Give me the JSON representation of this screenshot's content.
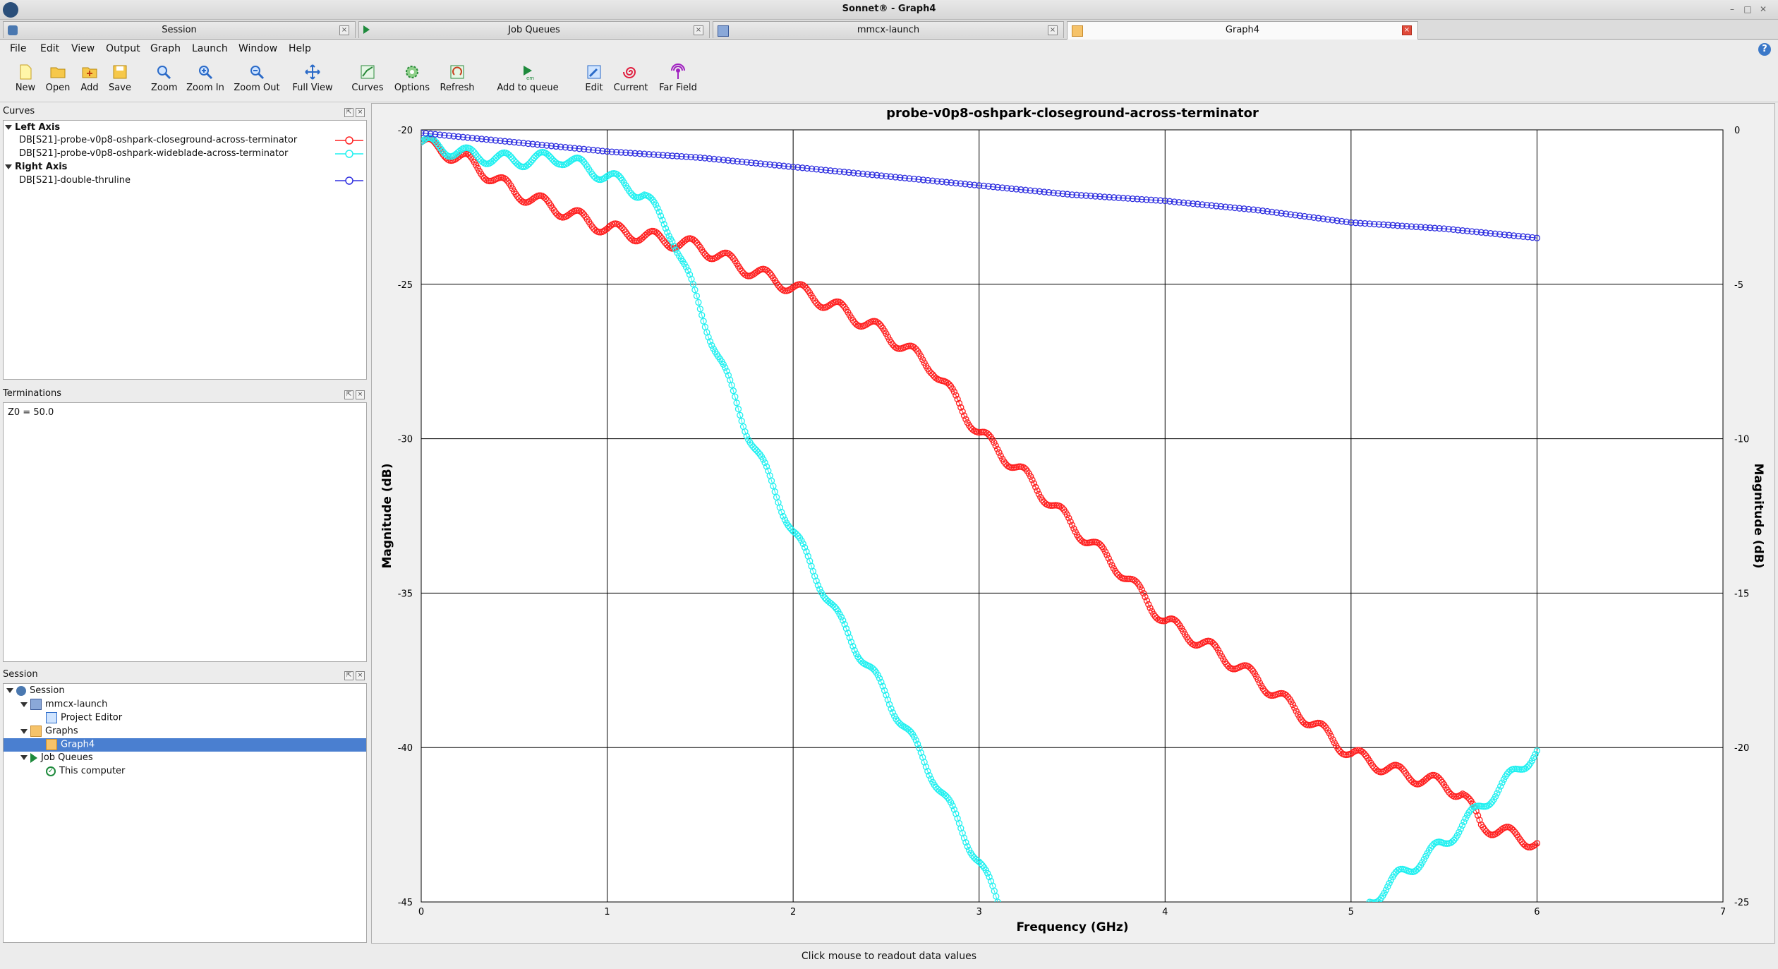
{
  "window": {
    "title": "Sonnet® - Graph4"
  },
  "tabs": [
    {
      "label": "Session",
      "active": false
    },
    {
      "label": "Job Queues",
      "active": false
    },
    {
      "label": "mmcx-launch",
      "active": false
    },
    {
      "label": "Graph4",
      "active": true
    }
  ],
  "menu": [
    "File",
    "Edit",
    "View",
    "Output",
    "Graph",
    "Launch",
    "Window",
    "Help"
  ],
  "toolbar": [
    "New",
    "Open",
    "Add",
    "Save",
    "Zoom",
    "Zoom In",
    "Zoom Out",
    "Full View",
    "Curves",
    "Options",
    "Refresh",
    "Add to queue",
    "Edit",
    "Current",
    "Far Field"
  ],
  "curves_panel": {
    "title": "Curves",
    "left_axis_label": "Left Axis",
    "right_axis_label": "Right Axis",
    "left_curves": [
      {
        "label": "DB[S21]-probe-v0p8-oshpark-closeground-across-terminator",
        "color": "#ff2020"
      },
      {
        "label": "DB[S21]-probe-v0p8-oshpark-wideblade-across-terminator",
        "color": "#20f0f0"
      }
    ],
    "right_curves": [
      {
        "label": "DB[S21]-double-thruline",
        "color": "#3030e0"
      }
    ]
  },
  "terminations_panel": {
    "title": "Terminations",
    "text": "Z0 = 50.0"
  },
  "session_panel": {
    "title": "Session",
    "items": [
      {
        "label": "Session"
      },
      {
        "label": "mmcx-launch"
      },
      {
        "label": "Project Editor"
      },
      {
        "label": "Graphs"
      },
      {
        "label": "Graph4",
        "selected": true
      },
      {
        "label": "Job Queues"
      },
      {
        "label": "This computer"
      }
    ]
  },
  "status": {
    "text": "Click mouse to readout data values"
  },
  "chart_data": {
    "type": "scatter",
    "title": "probe-v0p8-oshpark-closeground-across-terminator",
    "xlabel": "Frequency (GHz)",
    "ylabel_left": "Magnitude (dB)",
    "ylabel_right": "Magnitude (dB)",
    "xlim": [
      0,
      7
    ],
    "ylim_left": [
      -45,
      -20
    ],
    "ylim_right": [
      -25,
      0
    ],
    "x_ticks": [
      0,
      1,
      2,
      3,
      4,
      5,
      6,
      7
    ],
    "y_ticks_left": [
      -20,
      -25,
      -30,
      -35,
      -40,
      -45
    ],
    "y_ticks_right": [
      0,
      -5,
      -10,
      -15,
      -20,
      -25
    ],
    "grid": true,
    "series": [
      {
        "axis": "left",
        "color": "#ff2020",
        "points": [
          [
            0,
            -20.4
          ],
          [
            0.25,
            -21.0
          ],
          [
            0.5,
            -22.0
          ],
          [
            0.75,
            -22.6
          ],
          [
            1,
            -23.2
          ],
          [
            1.25,
            -23.5
          ],
          [
            1.5,
            -23.8
          ],
          [
            1.75,
            -24.5
          ],
          [
            2,
            -25.1
          ],
          [
            2.25,
            -25.8
          ],
          [
            2.5,
            -26.6
          ],
          [
            2.75,
            -27.7
          ],
          [
            3,
            -29.8
          ],
          [
            3.25,
            -31.2
          ],
          [
            3.5,
            -32.8
          ],
          [
            3.75,
            -34.2
          ],
          [
            4,
            -35.9
          ],
          [
            4.25,
            -36.8
          ],
          [
            4.5,
            -37.8
          ],
          [
            4.75,
            -39.0
          ],
          [
            5,
            -40.2
          ],
          [
            5.25,
            -40.8
          ],
          [
            5.5,
            -41.2
          ],
          [
            5.6,
            -41.5
          ],
          [
            5.7,
            -42.5
          ],
          [
            6,
            -43.1
          ]
        ]
      },
      {
        "axis": "left",
        "color": "#20f0f0",
        "points": [
          [
            0,
            -20.4
          ],
          [
            0.25,
            -20.8
          ],
          [
            0.5,
            -21.0
          ],
          [
            0.75,
            -20.9
          ],
          [
            1,
            -21.5
          ],
          [
            1.2,
            -22.1
          ],
          [
            1.35,
            -23.4
          ],
          [
            1.5,
            -25.8
          ],
          [
            1.75,
            -29.7
          ],
          [
            2,
            -33.0
          ],
          [
            2.25,
            -35.9
          ],
          [
            2.5,
            -38.3
          ],
          [
            2.75,
            -40.9
          ],
          [
            3,
            -43.7
          ],
          [
            3.1,
            -45.0
          ]
        ]
      },
      {
        "axis": "left",
        "color": "#20f0f0",
        "points": [
          [
            5.1,
            -45.0
          ],
          [
            5.25,
            -44.2
          ],
          [
            5.5,
            -43.1
          ],
          [
            5.75,
            -41.6
          ],
          [
            6,
            -40.1
          ]
        ]
      },
      {
        "axis": "right",
        "color": "#3030e0",
        "points": [
          [
            0,
            -0.1
          ],
          [
            0.5,
            -0.4
          ],
          [
            1,
            -0.7
          ],
          [
            1.5,
            -0.9
          ],
          [
            2,
            -1.2
          ],
          [
            2.5,
            -1.5
          ],
          [
            3,
            -1.8
          ],
          [
            3.5,
            -2.1
          ],
          [
            4,
            -2.3
          ],
          [
            4.5,
            -2.6
          ],
          [
            5,
            -3.0
          ],
          [
            5.5,
            -3.2
          ],
          [
            6,
            -3.5
          ]
        ]
      }
    ]
  }
}
